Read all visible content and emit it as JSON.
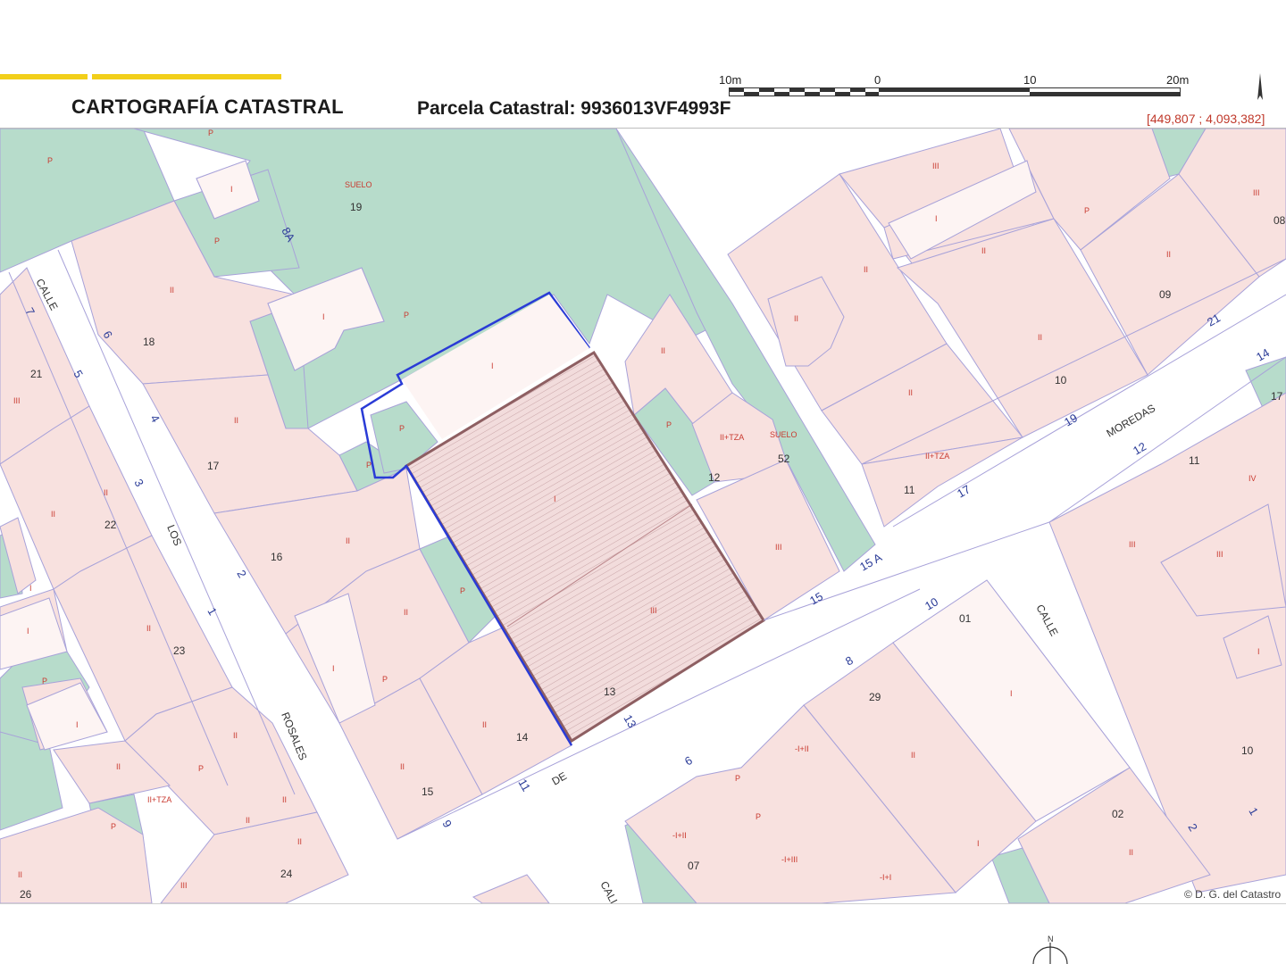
{
  "header": {
    "title": "CARTOGRAFÍA CATASTRAL",
    "parcel": "Parcela Catastral: 9936013VF4993F",
    "coordinates": "[449,807 ; 4,093,382]",
    "scale_labels": [
      "10m",
      "0",
      "10",
      "20m"
    ]
  },
  "map": {
    "streets": [
      "CALLE",
      "LOS",
      "ROSALES",
      "DE",
      "MOREDAS",
      "CALLE",
      "CALL"
    ],
    "parcel_numbers": [
      "19",
      "18",
      "17",
      "16",
      "21",
      "22",
      "23",
      "24",
      "26",
      "15",
      "14",
      "13",
      "12",
      "52",
      "11",
      "10",
      "09",
      "08",
      "01",
      "29",
      "02",
      "07",
      "10",
      "11",
      "17"
    ],
    "house_numbers": [
      "7",
      "6",
      "5",
      "4",
      "3",
      "2",
      "1",
      "8A",
      "9",
      "11",
      "13",
      "6",
      "8",
      "10",
      "15",
      "15 A",
      "17",
      "19",
      "21",
      "14",
      "12",
      "2",
      "1"
    ],
    "use_labels": [
      "SUELO",
      "SUELO",
      "P",
      "I",
      "II",
      "III",
      "IV",
      "II+TZA",
      "-I+II",
      "-I+I",
      "-I+III"
    ],
    "colors": {
      "building": "#f8e1df",
      "garden": "#b7dccb",
      "street": "#ffffff",
      "parcel_line": "#a8a2d9",
      "selected_outline": "#8e5f62",
      "blue_outline": "#2a3bd6",
      "label_red": "#c93a30",
      "label_blue": "#2b3c98"
    }
  },
  "footer": {
    "copyright": "© D. G. del Catastro",
    "north": "N"
  }
}
